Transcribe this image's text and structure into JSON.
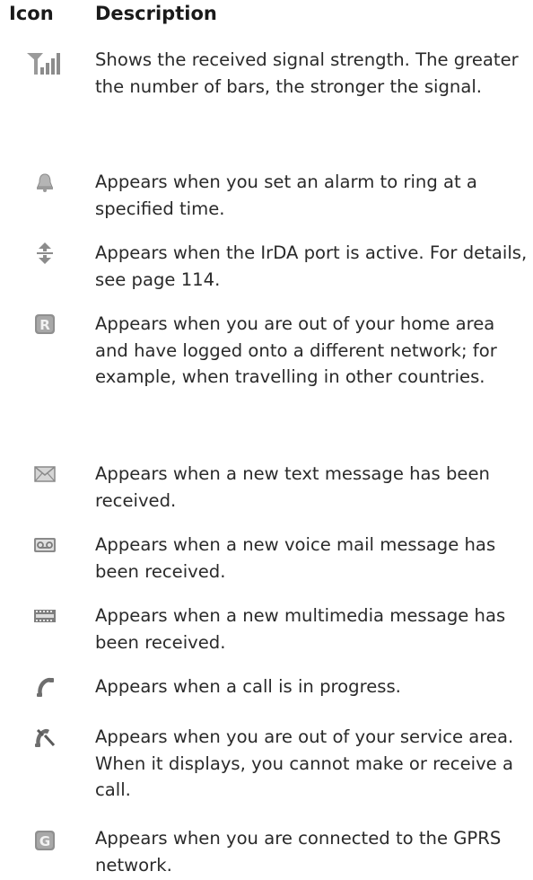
{
  "header": {
    "icon_label": "Icon",
    "description_label": "Description"
  },
  "rows": [
    {
      "icon": "signal-strength-icon",
      "description": "Shows the received signal strength. The greater the number of bars, the stronger the signal."
    },
    {
      "icon": "alarm-bell-icon",
      "description": "Appears when you set an alarm to ring at a specified time."
    },
    {
      "icon": "irda-arrows-icon",
      "description": "Appears when the IrDA port is active. For details, see page 114."
    },
    {
      "icon": "roaming-r-icon",
      "description": "Appears when you are out of your home area and have logged onto a different network; for example, when travelling in other countries."
    },
    {
      "icon": "text-message-envelope-icon",
      "description": "Appears when a new text message has been received."
    },
    {
      "icon": "voice-mail-icon",
      "description": "Appears when a new voice mail message has been received."
    },
    {
      "icon": "multimedia-message-icon",
      "description": "Appears when a new multimedia message has been received."
    },
    {
      "icon": "call-in-progress-icon",
      "description": "Appears when a call is in progress."
    },
    {
      "icon": "no-service-icon",
      "description": "Appears when you are out of your service area. When it displays, you cannot make or receive a call."
    },
    {
      "icon": "gprs-g-icon",
      "description": "Appears when you are connected to the GPRS network."
    }
  ]
}
